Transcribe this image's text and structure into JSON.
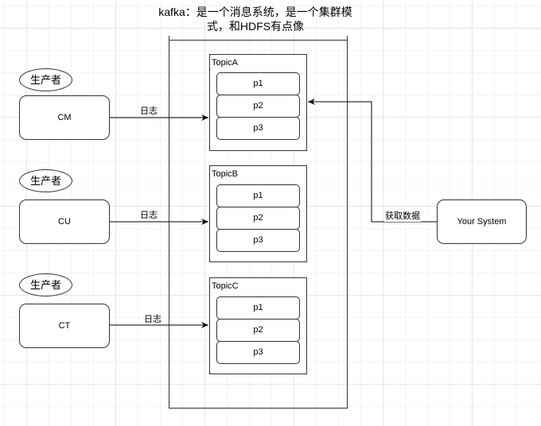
{
  "title": "kafka：是一个消息系统，是一个集群模式，和HDFS有点像",
  "producers": [
    {
      "role_label": "生产者",
      "name": "CM",
      "edge_label": "日志",
      "target": "TopicA"
    },
    {
      "role_label": "生产者",
      "name": "CU",
      "edge_label": "日志",
      "target": "TopicB"
    },
    {
      "role_label": "生产者",
      "name": "CT",
      "edge_label": "日志",
      "target": "TopicC"
    }
  ],
  "topics": [
    {
      "name": "TopicA",
      "partitions": [
        "p1",
        "p2",
        "p3"
      ]
    },
    {
      "name": "TopicB",
      "partitions": [
        "p1",
        "p2",
        "p3"
      ]
    },
    {
      "name": "TopicC",
      "partitions": [
        "p1",
        "p2",
        "p3"
      ]
    }
  ],
  "consumer": {
    "name": "Your System",
    "edge_label": "获取数据",
    "target": "TopicA"
  },
  "colors": {
    "stroke": "#333333",
    "grid": "#e6e6e6",
    "background": "#ffffff"
  }
}
